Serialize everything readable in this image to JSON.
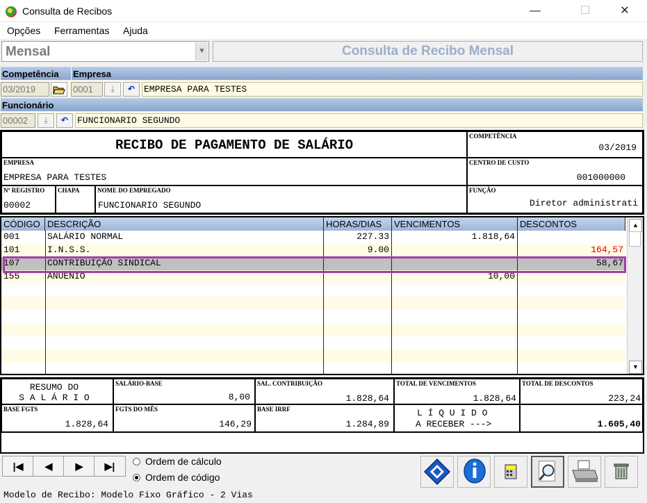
{
  "window": {
    "title": "Consulta de Recibos",
    "minimize": "—",
    "maximize": "☐",
    "close": "✕"
  },
  "menu": {
    "opcoes": "Opções",
    "ferramentas": "Ferramentas",
    "ajuda": "Ajuda"
  },
  "mode": {
    "selected": "Mensal",
    "title": "Consulta de Recibo Mensal"
  },
  "filters": {
    "competencia_label": "Competência",
    "empresa_label": "Empresa",
    "competencia_value": "03/2019",
    "empresa_code": "0001",
    "empresa_name": "EMPRESA PARA TESTES",
    "funcionario_label": "Funcionário",
    "funcionario_code": "00002",
    "funcionario_name": "FUNCIONARIO SEGUNDO"
  },
  "recibo": {
    "title": "RECIBO DE PAGAMENTO DE SALÁRIO",
    "competencia_label": "COMPETÊNCIA",
    "competencia_value": "03/2019",
    "empresa_label": "EMPRESA",
    "empresa_value": "EMPRESA PARA TESTES",
    "centro_label": "CENTRO DE CUSTO",
    "centro_value": "001000000",
    "registro_label": "Nº REGISTRO",
    "registro_value": "00002",
    "chapa_label": "CHAPA",
    "nome_label": "NOME DO EMPREGADO",
    "nome_value": "FUNCIONARIO SEGUNDO",
    "funcao_label": "FUNÇÃO",
    "funcao_value": "Diretor administrati"
  },
  "grid": {
    "headers": {
      "codigo": "CÓDIGO",
      "descricao": "DESCRIÇÃO",
      "horas": "HORAS/DIAS",
      "vencimentos": "VENCIMENTOS",
      "descontos": "DESCONTOS"
    },
    "rows": [
      {
        "codigo": "001",
        "descricao": "SALÁRIO NORMAL",
        "horas": "227.33",
        "vencimentos": "1.818,64",
        "descontos": ""
      },
      {
        "codigo": "101",
        "descricao": "I.N.S.S.",
        "horas": "9.00",
        "vencimentos": "",
        "descontos": "164,57"
      },
      {
        "codigo": "107",
        "descricao": "CONTRIBUIÇÃO SINDICAL",
        "horas": "",
        "vencimentos": "",
        "descontos": "58,67"
      },
      {
        "codigo": "155",
        "descricao": "ANUENIO",
        "horas": "",
        "vencimentos": "10,00",
        "descontos": ""
      }
    ],
    "scroll_up": "▲",
    "scroll_down": "▼"
  },
  "summary": {
    "resumo_line1": "RESUMO DO",
    "resumo_line2": "S A L Á R I O",
    "salario_base_label": "SALÁRIO-BASE",
    "salario_base_value": "8,00",
    "sal_contrib_label": "SAL. CONTRIBUIÇÃO",
    "sal_contrib_value": "1.828,64",
    "total_venc_label": "TOTAL DE VENCIMENTOS",
    "total_venc_value": "1.828,64",
    "total_desc_label": "TOTAL DE DESCONTOS",
    "total_desc_value": "223,24",
    "base_fgts_label": "BASE FGTS",
    "base_fgts_value": "1.828,64",
    "fgts_mes_label": "FGTS DO MÊS",
    "fgts_mes_value": "146,29",
    "base_irrf_label": "BASE IRRF",
    "base_irrf_value": "1.284,89",
    "liquido_line1": "L Í Q U I D O",
    "liquido_line2": "A RECEBER --->",
    "liquido_value": "1.605,40"
  },
  "nav": {
    "first": "|◀",
    "prev": "◀",
    "next": "▶",
    "last": "▶|"
  },
  "order": {
    "calculo": "Ordem de cálculo",
    "codigo": "Ordem de código",
    "selected": "codigo"
  },
  "status": "Modelo de Recibo: Modelo Fixo Gráfico - 2 Vias",
  "colors": {
    "header_blue": "#9fb6d8",
    "highlight": "#a23ea6",
    "selected_row": "#c0c0c0",
    "negative": "#e00000",
    "yellow": "#fffbe6"
  }
}
